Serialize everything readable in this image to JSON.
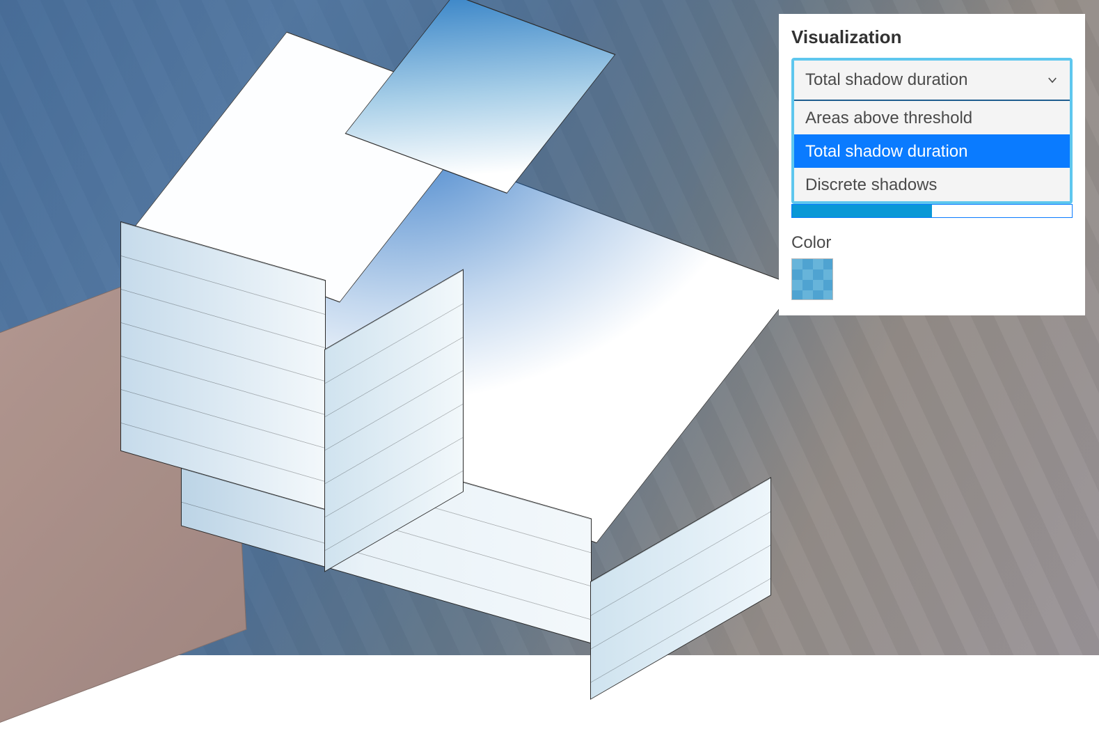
{
  "panel": {
    "title": "Visualization",
    "dropdown": {
      "selected_label": "Total shadow duration",
      "options": [
        {
          "label": "Areas above threshold",
          "selected": false
        },
        {
          "label": "Total shadow duration",
          "selected": true
        },
        {
          "label": "Discrete shadows",
          "selected": false
        }
      ]
    },
    "slider": {
      "fill_percent": 50
    },
    "color": {
      "label": "Color",
      "swatch_hex_a": "#4fa3d1",
      "swatch_hex_b": "#67b4da"
    }
  }
}
